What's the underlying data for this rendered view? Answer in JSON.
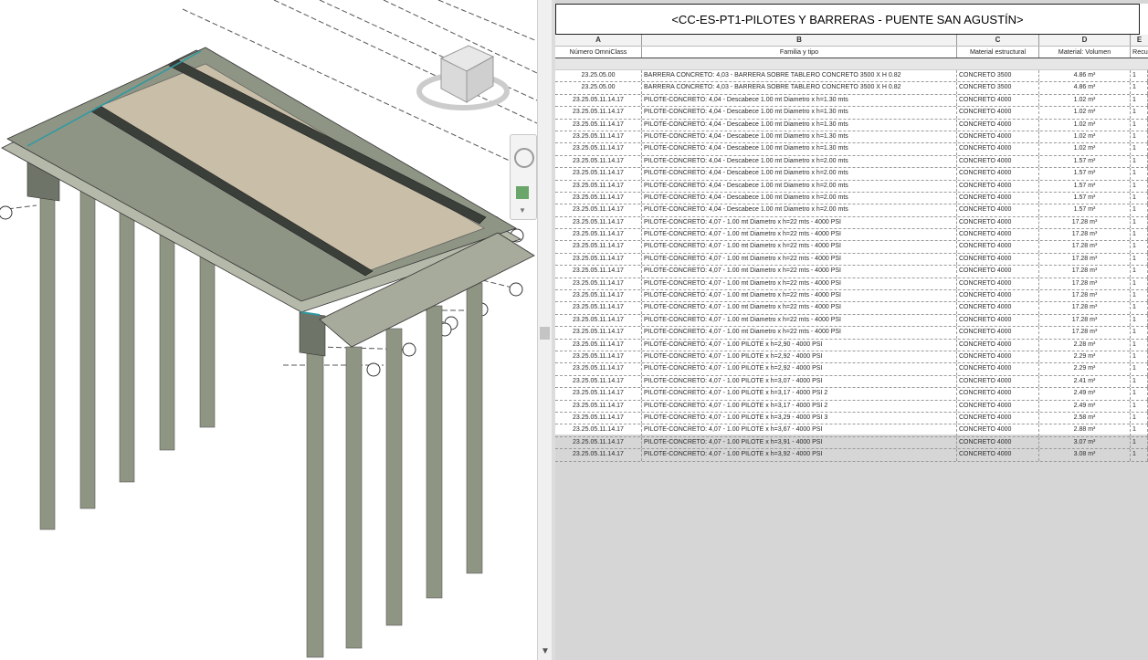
{
  "schedule": {
    "title": "<CC-ES-PT1-PILOTES Y BARRERAS - PUENTE SAN AGUSTÍN>",
    "column_letters": [
      "A",
      "B",
      "C",
      "D",
      "E"
    ],
    "columns": [
      "Número OmniClass",
      "Familia y tipo",
      "Material estructural",
      "Material: Volumen",
      "Recu"
    ],
    "rows": [
      [
        "23.25.05.00",
        "BARRERA CONCRETO: 4,03 - BARRERA SOBRE TABLERO CONCRETO 3500 X H 0.82",
        "CONCRETO 3500",
        "4.86 m³",
        "1"
      ],
      [
        "23.25.05.00",
        "BARRERA CONCRETO: 4,03 - BARRERA SOBRE TABLERO CONCRETO 3500 X H 0.82",
        "CONCRETO 3500",
        "4.86 m³",
        "1"
      ],
      [
        "23.25.05.11.14.17",
        "PILOTE-CONCRETO: 4,04 - Descabece 1.00 mt Diametro x h=1.30 mts",
        "CONCRETO 4000",
        "1.02 m³",
        "1"
      ],
      [
        "23.25.05.11.14.17",
        "PILOTE-CONCRETO: 4,04 - Descabece 1.00 mt Diametro x h=1.30 mts",
        "CONCRETO 4000",
        "1.02 m³",
        "1"
      ],
      [
        "23.25.05.11.14.17",
        "PILOTE-CONCRETO: 4,04 - Descabece 1.00 mt Diametro x h=1.30 mts",
        "CONCRETO 4000",
        "1.02 m³",
        "1"
      ],
      [
        "23.25.05.11.14.17",
        "PILOTE-CONCRETO: 4,04 - Descabece 1.00 mt Diametro x h=1.30 mts",
        "CONCRETO 4000",
        "1.02 m³",
        "1"
      ],
      [
        "23.25.05.11.14.17",
        "PILOTE-CONCRETO: 4,04 - Descabece 1.00 mt Diametro x h=1.30 mts",
        "CONCRETO 4000",
        "1.02 m³",
        "1"
      ],
      [
        "23.25.05.11.14.17",
        "PILOTE-CONCRETO: 4,04 - Descabece 1.00 mt Diametro x h=2.00 mts",
        "CONCRETO 4000",
        "1.57 m³",
        "1"
      ],
      [
        "23.25.05.11.14.17",
        "PILOTE-CONCRETO: 4,04 - Descabece 1.00 mt Diametro x h=2.00 mts",
        "CONCRETO 4000",
        "1.57 m³",
        "1"
      ],
      [
        "23.25.05.11.14.17",
        "PILOTE-CONCRETO: 4,04 - Descabece 1.00 mt Diametro x h=2.00 mts",
        "CONCRETO 4000",
        "1.57 m³",
        "1"
      ],
      [
        "23.25.05.11.14.17",
        "PILOTE-CONCRETO: 4,04 - Descabece 1.00 mt Diametro x h=2.00 mts",
        "CONCRETO 4000",
        "1.57 m³",
        "1"
      ],
      [
        "23.25.05.11.14.17",
        "PILOTE-CONCRETO: 4,04 - Descabece 1.00 mt Diametro x h=2.00 mts",
        "CONCRETO 4000",
        "1.57 m³",
        "1"
      ],
      [
        "23.25.05.11.14.17",
        "PILOTE-CONCRETO: 4,07 - 1.00 mt Diametro x h=22 mts - 4000 PSI",
        "CONCRETO 4000",
        "17.28 m³",
        "1"
      ],
      [
        "23.25.05.11.14.17",
        "PILOTE-CONCRETO: 4,07 - 1.00 mt Diametro x h=22 mts - 4000 PSI",
        "CONCRETO 4000",
        "17.28 m³",
        "1"
      ],
      [
        "23.25.05.11.14.17",
        "PILOTE-CONCRETO: 4,07 - 1.00 mt Diametro x h=22 mts - 4000 PSI",
        "CONCRETO 4000",
        "17.28 m³",
        "1"
      ],
      [
        "23.25.05.11.14.17",
        "PILOTE-CONCRETO: 4,07 - 1.00 mt Diametro x h=22 mts - 4000 PSI",
        "CONCRETO 4000",
        "17.28 m³",
        "1"
      ],
      [
        "23.25.05.11.14.17",
        "PILOTE-CONCRETO: 4,07 - 1.00 mt Diametro x h=22 mts - 4000 PSI",
        "CONCRETO 4000",
        "17.28 m³",
        "1"
      ],
      [
        "23.25.05.11.14.17",
        "PILOTE-CONCRETO: 4,07 - 1.00 mt Diametro x h=22 mts - 4000 PSI",
        "CONCRETO 4000",
        "17.28 m³",
        "1"
      ],
      [
        "23.25.05.11.14.17",
        "PILOTE-CONCRETO: 4,07 - 1.00 mt Diametro x h=22 mts - 4000 PSI",
        "CONCRETO 4000",
        "17.28 m³",
        "1"
      ],
      [
        "23.25.05.11.14.17",
        "PILOTE-CONCRETO: 4,07 - 1.00 mt Diametro x h=22 mts - 4000 PSI",
        "CONCRETO 4000",
        "17.28 m³",
        "1"
      ],
      [
        "23.25.05.11.14.17",
        "PILOTE-CONCRETO: 4,07 - 1.00 mt Diametro x h=22 mts - 4000 PSI",
        "CONCRETO 4000",
        "17.28 m³",
        "1"
      ],
      [
        "23.25.05.11.14.17",
        "PILOTE-CONCRETO: 4,07 - 1.00 mt Diametro x h=22 mts - 4000 PSI",
        "CONCRETO 4000",
        "17.28 m³",
        "1"
      ],
      [
        "23.25.05.11.14.17",
        "PILOTE-CONCRETO: 4,07 - 1.00 PILOTE x h=2,90 - 4000 PSI",
        "CONCRETO 4000",
        "2.28 m³",
        "1"
      ],
      [
        "23.25.05.11.14.17",
        "PILOTE-CONCRETO: 4,07 - 1.00 PILOTE x h=2,92 - 4000 PSI",
        "CONCRETO 4000",
        "2.29 m³",
        "1"
      ],
      [
        "23.25.05.11.14.17",
        "PILOTE-CONCRETO: 4,07 - 1.00 PILOTE x h=2,92 - 4000 PSI",
        "CONCRETO 4000",
        "2.29 m³",
        "1"
      ],
      [
        "23.25.05.11.14.17",
        "PILOTE-CONCRETO: 4,07 - 1.00 PILOTE x h=3,07 - 4000 PSI",
        "CONCRETO 4000",
        "2.41 m³",
        "1"
      ],
      [
        "23.25.05.11.14.17",
        "PILOTE-CONCRETO: 4,07 - 1.00 PILOTE x h=3,17 - 4000 PSI 2",
        "CONCRETO 4000",
        "2.49 m³",
        "1"
      ],
      [
        "23.25.05.11.14.17",
        "PILOTE-CONCRETO: 4,07 - 1.00 PILOTE x h=3,17 - 4000 PSI 2",
        "CONCRETO 4000",
        "2.49 m³",
        "1"
      ],
      [
        "23.25.05.11.14.17",
        "PILOTE-CONCRETO: 4,07 - 1.00 PILOTE x h=3,29 - 4000 PSI 3",
        "CONCRETO 4000",
        "2.58 m³",
        "1"
      ],
      [
        "23.25.05.11.14.17",
        "PILOTE-CONCRETO: 4,07 - 1.00 PILOTE x h=3,67 - 4000 PSI",
        "CONCRETO 4000",
        "2.88 m³",
        "1"
      ],
      [
        "23.25.05.11.14.17",
        "PILOTE-CONCRETO: 4,07 - 1.00 PILOTE x h=3,91 - 4000 PSI",
        "CONCRETO 4000",
        "3.07 m³",
        "1"
      ],
      [
        "23.25.05.11.14.17",
        "PILOTE-CONCRETO: 4,07 - 1.00 PILOTE x h=3,92 - 4000 PSI",
        "CONCRETO 4000",
        "3.08 m³",
        "1"
      ]
    ]
  },
  "viewcube": {
    "icon": "viewcube-icon"
  },
  "navigation_bar": {
    "icons": [
      "steering-wheel-icon",
      "zoom-icon",
      "expand-arrow-icon"
    ]
  },
  "colors": {
    "deck": "#8e9585",
    "deck_top": "#c9bfa8",
    "pile": "#9aa08f",
    "barrier": "#3b3f3a"
  }
}
